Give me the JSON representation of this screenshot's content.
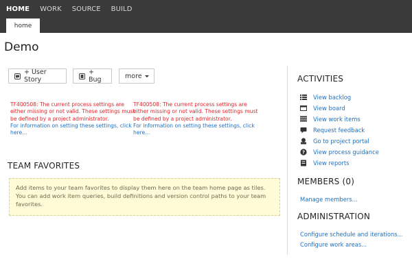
{
  "topnav": {
    "items": [
      {
        "label": "HOME",
        "active": true
      },
      {
        "label": "WORK",
        "active": false
      },
      {
        "label": "SOURCE",
        "active": false
      },
      {
        "label": "BUILD",
        "active": false
      }
    ],
    "subtab": "home"
  },
  "page": {
    "title": "Demo"
  },
  "toolbar": {
    "user_story": "+ User Story",
    "bug": "+ Bug",
    "more": "more"
  },
  "errors": [
    {
      "message": "TF400508: The current process settings are either missing or not valid. These settings must be defined by a project administrator.",
      "link": "For information on setting these settings, click here..."
    },
    {
      "message": "TF400508: The current process settings are either missing or not valid. These settings must be defined by a project administrator.",
      "link": "For information on setting these settings, click here..."
    }
  ],
  "team_favorites": {
    "heading": "TEAM FAVORITES",
    "hint": "Add items to your team favorites to display them here on the team home page as tiles. You can add work item queries, build definitions and version control paths to your team favorites."
  },
  "activities": {
    "heading": "ACTIVITIES",
    "items": [
      {
        "label": "View backlog",
        "icon": "backlog-icon"
      },
      {
        "label": "View board",
        "icon": "board-icon"
      },
      {
        "label": "View work items",
        "icon": "work-items-icon"
      },
      {
        "label": "Request feedback",
        "icon": "feedback-icon"
      },
      {
        "label": "Go to project portal",
        "icon": "portal-icon"
      },
      {
        "label": "View process guidance",
        "icon": "help-icon"
      },
      {
        "label": "View reports",
        "icon": "reports-icon"
      }
    ]
  },
  "members": {
    "heading": "MEMBERS (0)",
    "manage": "Manage members..."
  },
  "administration": {
    "heading": "ADMINISTRATION",
    "schedule": "Configure schedule and iterations...",
    "areas": "Configure work areas..."
  },
  "colors": {
    "topbar": "#3a3a3a",
    "link": "#1f6fc1",
    "error": "#e0242a",
    "favorites_bg": "#fffbd6"
  }
}
